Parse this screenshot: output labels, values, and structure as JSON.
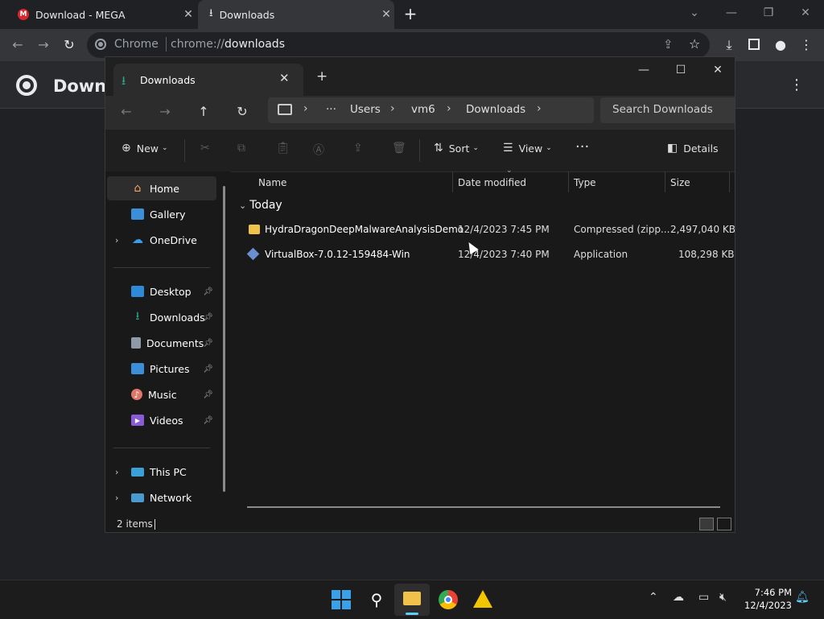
{
  "browser": {
    "tabs": [
      {
        "label": "Download - MEGA"
      },
      {
        "label": "Downloads"
      }
    ],
    "omnibox": {
      "origin": "Chrome",
      "url_prefix": "chrome://",
      "url_path": "downloads"
    },
    "page_title": "Downlo"
  },
  "explorer": {
    "tab_label": "Downloads",
    "breadcrumbs": [
      "Users",
      "vm6",
      "Downloads"
    ],
    "search_placeholder": "Search Downloads",
    "commands": {
      "new": "New",
      "sort": "Sort",
      "view": "View",
      "details": "Details"
    },
    "nav_items": [
      {
        "label": "Home"
      },
      {
        "label": "Gallery"
      },
      {
        "label": "OneDrive"
      },
      {
        "label": "Desktop"
      },
      {
        "label": "Downloads"
      },
      {
        "label": "Documents"
      },
      {
        "label": "Pictures"
      },
      {
        "label": "Music"
      },
      {
        "label": "Videos"
      },
      {
        "label": "This PC"
      },
      {
        "label": "Network"
      }
    ],
    "columns": [
      "Name",
      "Date modified",
      "Type",
      "Size"
    ],
    "group": "Today",
    "files": [
      {
        "name": "HydraDragonDeepMalwareAnalysisDemo",
        "date": "12/4/2023 7:45 PM",
        "type": "Compressed (zipp...",
        "size": "2,497,040 KB"
      },
      {
        "name": "VirtualBox-7.0.12-159484-Win",
        "date": "12/4/2023 7:40 PM",
        "type": "Application",
        "size": "108,298 KB"
      }
    ],
    "status": "2 items"
  },
  "taskbar": {
    "time": "7:46 PM",
    "date": "12/4/2023"
  },
  "colors": {
    "accent": "#2ca58d",
    "mega_red": "#d9272e",
    "folder_yellow": "#f0c24a"
  }
}
